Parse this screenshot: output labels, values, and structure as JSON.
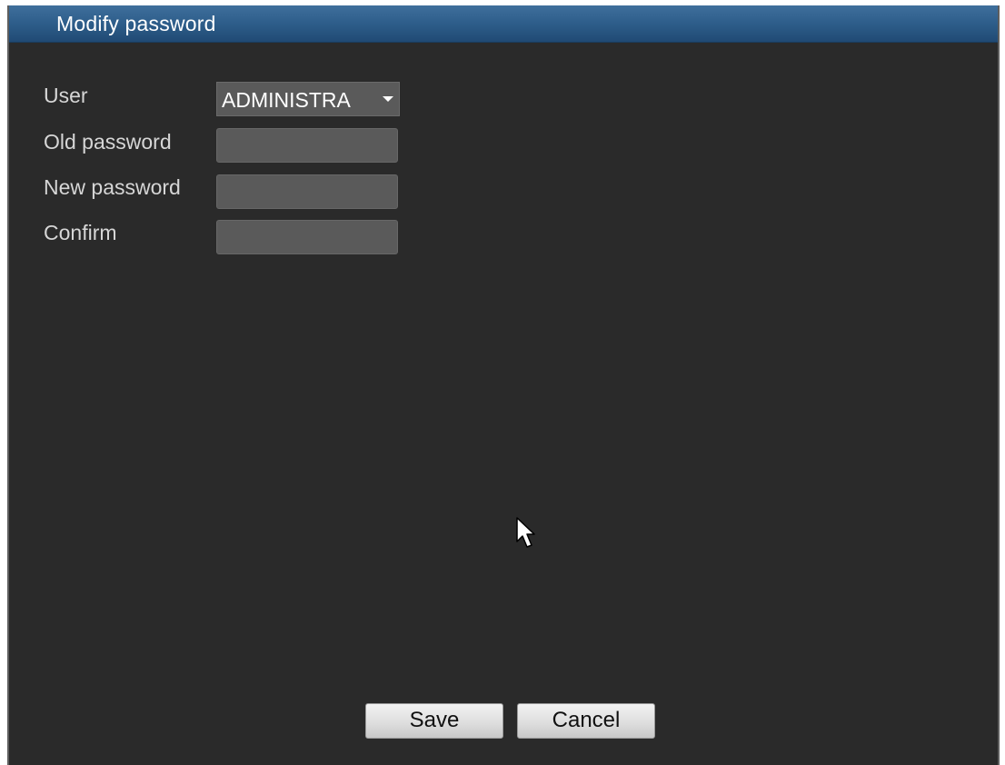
{
  "dialog": {
    "title": "Modify password"
  },
  "form": {
    "user_label": "User",
    "user_value": "ADMINISTRA",
    "old_password_label": "Old password",
    "old_password_value": "",
    "new_password_label": "New password",
    "new_password_value": "",
    "confirm_label": "Confirm",
    "confirm_value": ""
  },
  "buttons": {
    "save": "Save",
    "cancel": "Cancel"
  },
  "icons": {
    "dropdown": "chevron-down-icon",
    "pointer": "mouse-cursor-icon"
  },
  "colors": {
    "title_bar": "#2f5f8c",
    "background": "#2a2a2a",
    "field": "#5a5a5a"
  }
}
